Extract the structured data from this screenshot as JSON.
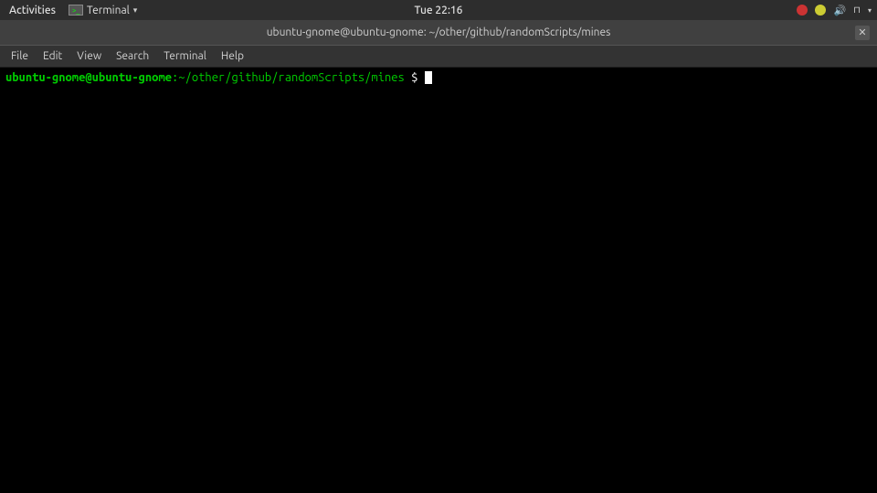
{
  "system_bar": {
    "activities_label": "Activities",
    "terminal_label": "Terminal",
    "datetime": "Tue 22:16",
    "chevron": "▾"
  },
  "title_bar": {
    "title": "ubuntu-gnome@ubuntu-gnome: ~/other/github/randomScripts/mines",
    "close_label": "✕"
  },
  "menu_bar": {
    "items": [
      {
        "label": "File"
      },
      {
        "label": "Edit"
      },
      {
        "label": "View"
      },
      {
        "label": "Search"
      },
      {
        "label": "Terminal"
      },
      {
        "label": "Help"
      }
    ]
  },
  "terminal": {
    "prompt_user": "ubuntu-gnome@ubuntu-gnome",
    "prompt_colon": ":",
    "prompt_path": "~/other/github/randomScripts/mines",
    "prompt_dollar": "$"
  }
}
